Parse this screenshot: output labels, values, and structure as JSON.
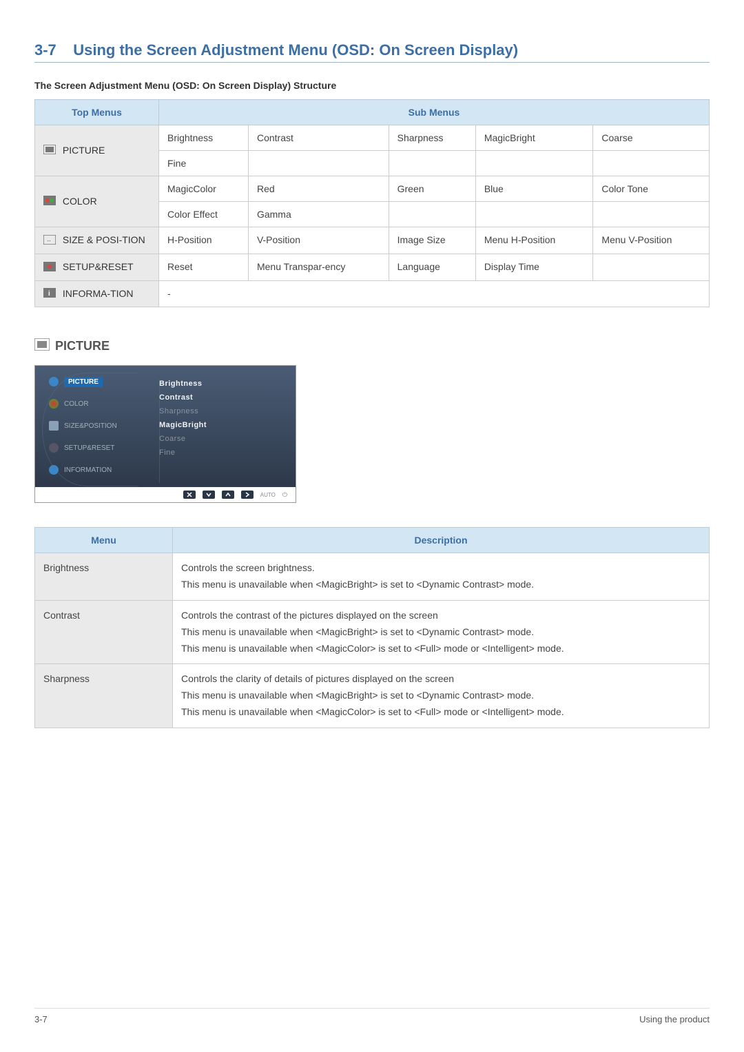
{
  "section": {
    "number": "3-7",
    "title": "Using the Screen Adjustment Menu (OSD: On Screen Display)"
  },
  "sub1": "The Screen Adjustment Menu (OSD: On Screen Display) Structure",
  "structure": {
    "top_header": "Top Menus",
    "sub_header": "Sub Menus",
    "rows": [
      {
        "name": "PICTURE",
        "cells": [
          [
            "Brightness",
            "Contrast",
            "Sharpness",
            "MagicBright",
            "Coarse"
          ],
          [
            "Fine",
            "",
            "",
            "",
            ""
          ]
        ]
      },
      {
        "name": "COLOR",
        "cells": [
          [
            "MagicColor",
            "Red",
            "Green",
            "Blue",
            "Color Tone"
          ],
          [
            "Color Effect",
            "Gamma",
            "",
            "",
            ""
          ]
        ]
      },
      {
        "name": "SIZE & POSI-TION",
        "cells": [
          [
            "H-Position",
            "V-Position",
            "Image Size",
            "Menu H-Position",
            "Menu V-Position"
          ]
        ]
      },
      {
        "name": "SETUP&RESET",
        "cells": [
          [
            "Reset",
            "Menu Transpar-ency",
            "Language",
            "Display Time",
            ""
          ]
        ]
      },
      {
        "name": "INFORMA-TION",
        "cells": [
          [
            "-",
            "",
            "",
            "",
            ""
          ]
        ]
      }
    ]
  },
  "picture_heading": "PICTURE",
  "osd": {
    "left": [
      {
        "label": "PICTURE",
        "selected": true
      },
      {
        "label": "COLOR",
        "selected": false
      },
      {
        "label": "SIZE&POSITION",
        "selected": false
      },
      {
        "label": "SETUP&RESET",
        "selected": false
      },
      {
        "label": "INFORMATION",
        "selected": false
      }
    ],
    "right": [
      {
        "label": "Brightness",
        "active": true
      },
      {
        "label": "Contrast",
        "active": true
      },
      {
        "label": "Sharpness",
        "active": false
      },
      {
        "label": "MagicBright",
        "active": true
      },
      {
        "label": "Coarse",
        "active": false
      },
      {
        "label": "Fine",
        "active": false
      }
    ],
    "auto": "AUTO"
  },
  "desc_table": {
    "menu_header": "Menu",
    "desc_header": "Description",
    "rows": [
      {
        "menu": "Brightness",
        "lines": [
          "Controls the screen brightness.",
          "This menu is unavailable when <MagicBright> is set to <Dynamic Contrast> mode."
        ]
      },
      {
        "menu": "Contrast",
        "lines": [
          "Controls the contrast of the pictures displayed on the screen",
          "This menu is unavailable when <MagicBright> is set to <Dynamic Contrast> mode.",
          "This menu is unavailable when <MagicColor> is set to <Full> mode or <Intelligent> mode."
        ]
      },
      {
        "menu": "Sharpness",
        "lines": [
          "Controls the clarity of details of pictures displayed on the screen",
          "This menu is unavailable when <MagicBright> is set to <Dynamic Contrast> mode.",
          "This menu is unavailable when <MagicColor> is set to <Full> mode or <Intelligent> mode."
        ]
      }
    ]
  },
  "footer": {
    "left": "3-7",
    "right": "Using the product"
  }
}
